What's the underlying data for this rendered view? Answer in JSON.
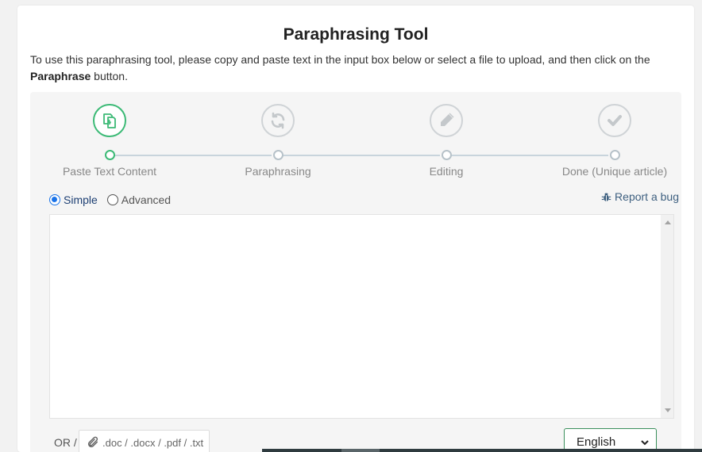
{
  "page": {
    "title": "Paraphrasing Tool",
    "intro_text": "To use this paraphrasing tool, please copy and paste text in the input box below or select a file to upload, and then click on the ",
    "intro_bold": "Paraphrase",
    "intro_end": " button."
  },
  "steps": [
    {
      "label": "Paste Text Content",
      "icon": "paste-icon",
      "active": true
    },
    {
      "label": "Paraphrasing",
      "icon": "refresh-icon",
      "active": false
    },
    {
      "label": "Editing",
      "icon": "pencil-icon",
      "active": false
    },
    {
      "label": "Done (Unique article)",
      "icon": "check-icon",
      "active": false
    }
  ],
  "mode": {
    "options": [
      "Simple",
      "Advanced"
    ],
    "selected": "Simple"
  },
  "report_bug": {
    "label": "Report a bug",
    "icon": "bug-icon"
  },
  "input": {
    "value": "",
    "placeholder": ""
  },
  "upload": {
    "or_label": "OR /",
    "label": ".doc / .docx / .pdf / .txt",
    "icon": "paperclip-icon"
  },
  "language": {
    "selected": "English",
    "options": [
      "English"
    ]
  },
  "colors": {
    "accent_green": "#3cba76",
    "link_blue": "#3d5f7f",
    "radio_blue": "#1a73e8"
  }
}
